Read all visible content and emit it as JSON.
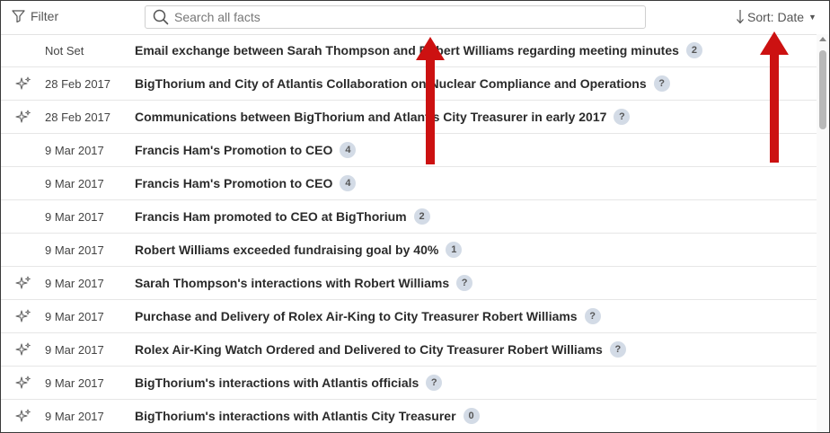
{
  "toolbar": {
    "filter_label": "Filter",
    "filter_icon": "funnel-icon",
    "search_placeholder": "Search all facts",
    "search_value": "",
    "sort_label": "Sort: Date",
    "sort_icon": "arrow-down-icon"
  },
  "rows": [
    {
      "date": "Not Set",
      "title": "Email exchange between Sarah Thompson and Robert Williams regarding meeting minutes",
      "badge": "2",
      "starred": false
    },
    {
      "date": "28 Feb 2017",
      "title": "BigThorium and City of Atlantis Collaboration on Nuclear Compliance and Operations",
      "badge": "?",
      "starred": true
    },
    {
      "date": "28 Feb 2017",
      "title": "Communications between BigThorium and Atlantis City Treasurer in early 2017",
      "badge": "?",
      "starred": true
    },
    {
      "date": "9 Mar 2017",
      "title": "Francis Ham's Promotion to CEO",
      "badge": "4",
      "starred": false
    },
    {
      "date": "9 Mar 2017",
      "title": "Francis Ham's Promotion to CEO",
      "badge": "4",
      "starred": false
    },
    {
      "date": "9 Mar 2017",
      "title": "Francis Ham promoted to CEO at BigThorium",
      "badge": "2",
      "starred": false
    },
    {
      "date": "9 Mar 2017",
      "title": "Robert Williams exceeded fundraising goal by 40%",
      "badge": "1",
      "starred": false
    },
    {
      "date": "9 Mar 2017",
      "title": "Sarah Thompson's interactions with Robert Williams",
      "badge": "?",
      "starred": true
    },
    {
      "date": "9 Mar 2017",
      "title": "Purchase and Delivery of Rolex Air-King to City Treasurer Robert Williams",
      "badge": "?",
      "starred": true
    },
    {
      "date": "9 Mar 2017",
      "title": "Rolex Air-King Watch Ordered and Delivered to City Treasurer Robert Williams",
      "badge": "?",
      "starred": true
    },
    {
      "date": "9 Mar 2017",
      "title": "BigThorium's interactions with Atlantis officials",
      "badge": "?",
      "starred": true
    },
    {
      "date": "9 Mar 2017",
      "title": "BigThorium's interactions with Atlantis City Treasurer",
      "badge": "0",
      "starred": true
    }
  ],
  "colors": {
    "annotation_arrow": "#cc1111",
    "badge_bg": "#d3dbe6",
    "row_divider": "#e6e6e6"
  }
}
